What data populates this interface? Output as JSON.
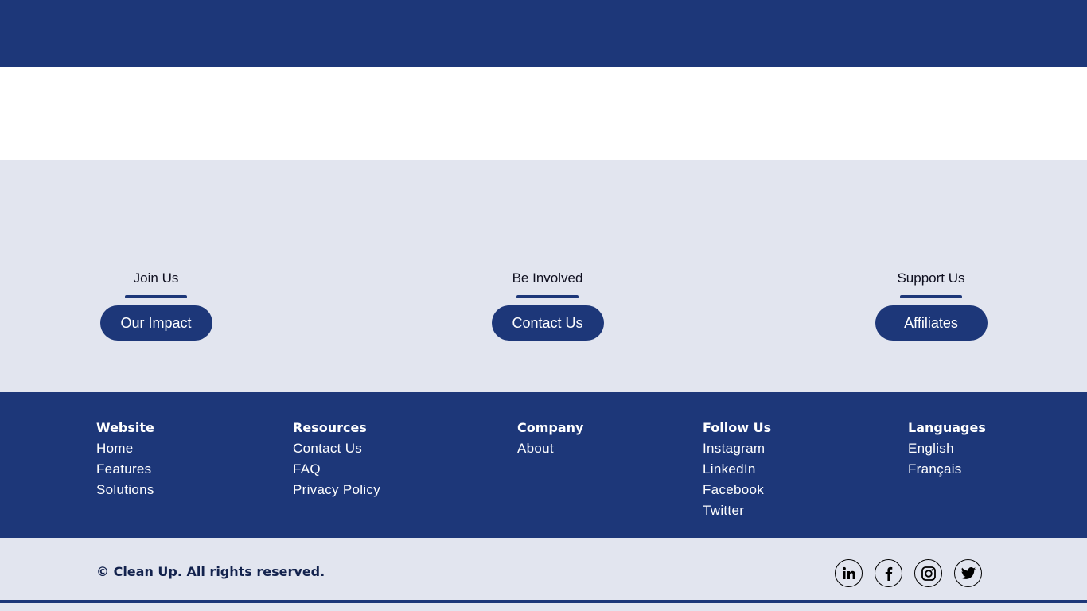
{
  "cta": [
    {
      "heading": "Join Us",
      "button": "Our Impact"
    },
    {
      "heading": "Be Involved",
      "button": "Contact Us"
    },
    {
      "heading": "Support Us",
      "button": "Affiliates"
    }
  ],
  "footer": {
    "columns": [
      {
        "title": "Website",
        "links": [
          "Home",
          "Features",
          "Solutions"
        ]
      },
      {
        "title": "Resources",
        "links": [
          "Contact Us",
          "FAQ",
          "Privacy Policy"
        ]
      },
      {
        "title": "Company",
        "links": [
          "About"
        ]
      },
      {
        "title": "Follow Us",
        "links": [
          "Instagram",
          "LinkedIn",
          "Facebook",
          "Twitter"
        ]
      },
      {
        "title": "Languages",
        "links": [
          "English",
          "Français"
        ]
      }
    ],
    "copyright": "© Clean Up. All rights reserved.",
    "social_icons": [
      "linkedin-icon",
      "facebook-icon",
      "instagram-icon",
      "twitter-icon"
    ]
  },
  "colors": {
    "brand_navy": "#1d3779",
    "light_background": "#e2e5ef",
    "white": "#ffffff"
  }
}
